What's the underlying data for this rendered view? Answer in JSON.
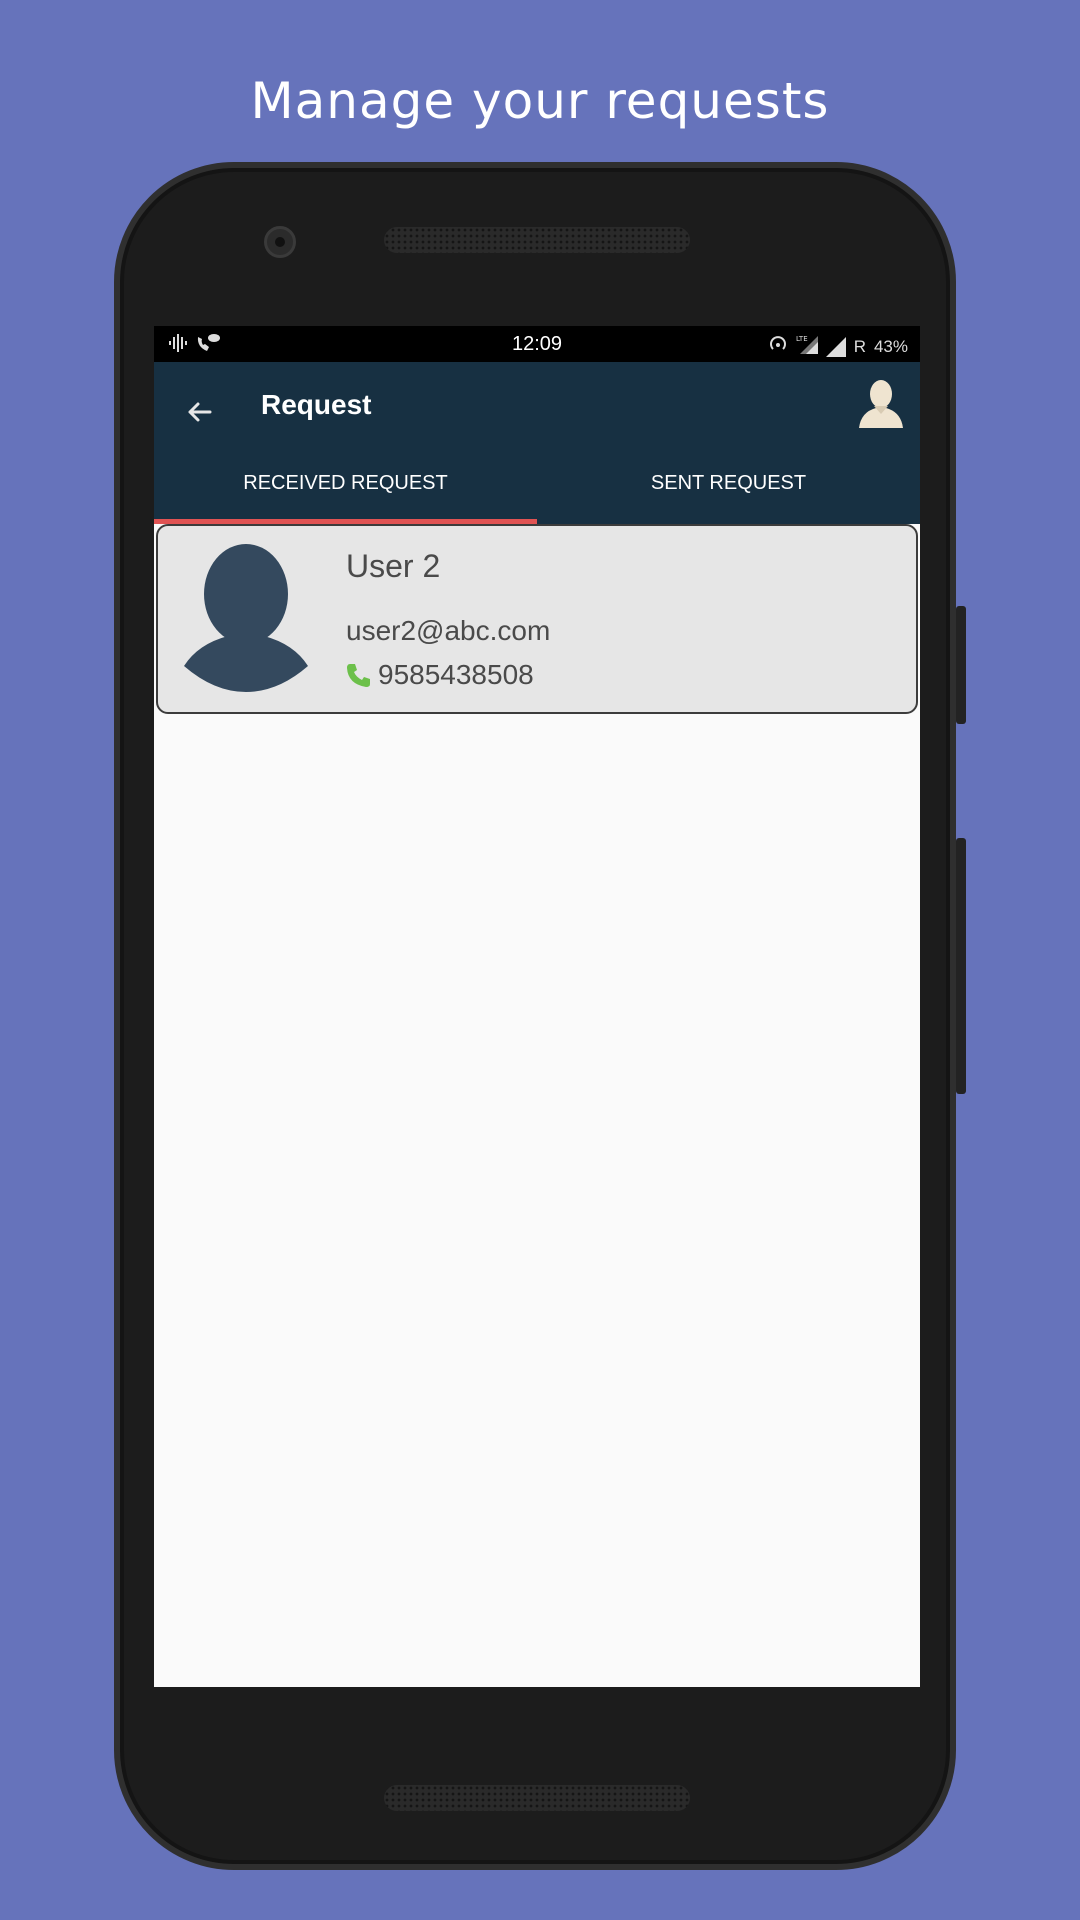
{
  "headline": "Manage your requests",
  "status_bar": {
    "time": "12:09",
    "left_icons": [
      "voicemail-icon",
      "wifi-call-icon"
    ],
    "right_icons": [
      "hotspot-icon",
      "lte-signal-icon",
      "signal-icon"
    ],
    "roaming": "R",
    "battery": "43%"
  },
  "app_bar": {
    "title": "Request",
    "back_icon": "arrow-back-icon",
    "profile_icon": "user-avatar-icon"
  },
  "tabs": [
    {
      "label": "RECEIVED REQUEST",
      "active": true
    },
    {
      "label": "SENT REQUEST",
      "active": false
    }
  ],
  "requests": [
    {
      "name": "User 2",
      "email": "user2@abc.com",
      "phone": "9585438508",
      "avatar_icon": "person-silhouette-icon",
      "phone_icon": "phone-icon"
    }
  ],
  "colors": {
    "background": "#6673bb",
    "app_bar": "#173042",
    "tab_indicator": "#e05353",
    "card_background": "#e6e6e6",
    "phone_icon": "#6cc04a",
    "avatar": "#34495e"
  }
}
